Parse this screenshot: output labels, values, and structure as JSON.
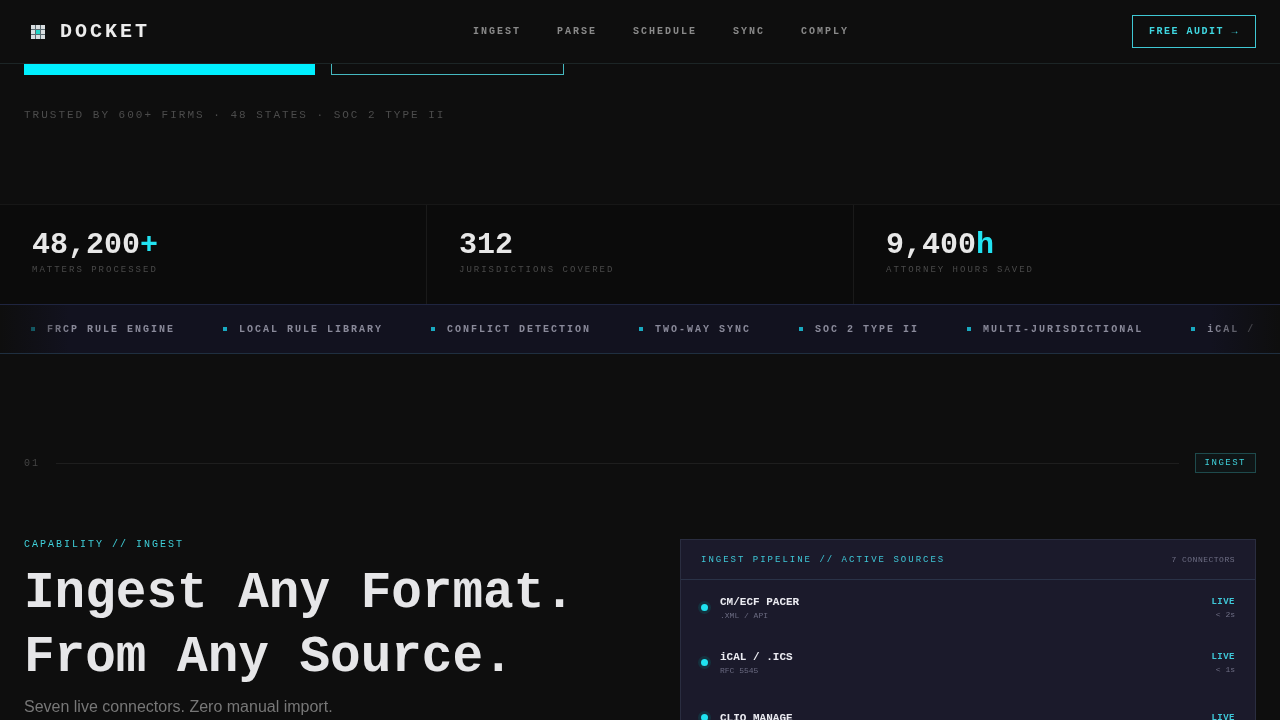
{
  "nav": {
    "brand": "DOCKET",
    "links": [
      "INGEST",
      "PARSE",
      "SCHEDULE",
      "SYNC",
      "COMPLY"
    ],
    "cta": "FREE AUDIT →"
  },
  "hero": {
    "buttons": [
      {
        "kind": "primary"
      },
      {
        "kind": "outline"
      }
    ],
    "trust": "TRUSTED BY 600+ FIRMS · 48 STATES · SOC 2 TYPE II"
  },
  "stats": [
    {
      "value": "48,200",
      "suffix": "+",
      "label": "MATTERS PROCESSED"
    },
    {
      "value": "312",
      "label": "JURISDICTIONS COVERED"
    },
    {
      "value": "9,400",
      "suffix": "h",
      "label": "ATTORNEY HOURS SAVED"
    }
  ],
  "ticker": [
    "FRCP RULE ENGINE",
    "LOCAL RULE LIBRARY",
    "CONFLICT DETECTION",
    "TWO-WAY SYNC",
    "SOC 2 TYPE II",
    "MULTI-JURISDICTIONAL",
    "iCAL /"
  ],
  "section": {
    "number": "01",
    "tag": "INGEST",
    "eyebrow": "CAPABILITY // INGEST",
    "heading_lines": [
      "Ingest Any Format.",
      "From Any Source."
    ],
    "subtitle": "Seven live connectors. Zero manual import."
  },
  "panel": {
    "title": "INGEST PIPELINE // ACTIVE SOURCES",
    "count": "7 CONNECTORS",
    "rows": [
      {
        "name": "CM/ECF PACER",
        "detail": ".XML / API",
        "status": "LIVE",
        "latency": "< 2s"
      },
      {
        "name": "iCAL / .ICS",
        "detail": "RFC 5545",
        "status": "LIVE",
        "latency": "< 1s"
      },
      {
        "name": "CLIO MANAGE",
        "status": "LIVE"
      }
    ]
  }
}
